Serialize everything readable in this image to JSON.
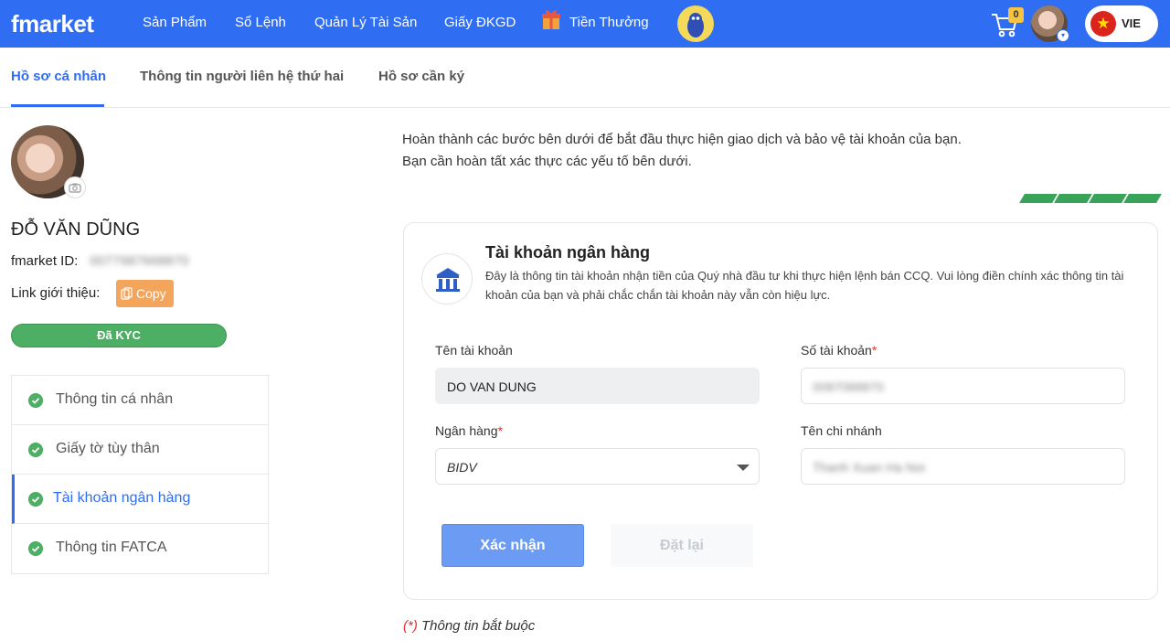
{
  "header": {
    "logo": "fmarket",
    "nav": [
      "Sản Phẩm",
      "Sổ Lệnh",
      "Quản Lý Tài Sản",
      "Giấy ĐKGD",
      "Tiền Thưởng"
    ],
    "cart_count": "0",
    "language": "VIE"
  },
  "tabs": [
    "Hồ sơ cá nhân",
    "Thông tin người liên hệ thứ hai",
    "Hồ sơ cần ký"
  ],
  "profile": {
    "name": "ĐỖ VĂN DŨNG",
    "fmarket_id_label": "fmarket ID:",
    "fmarket_id_value": "0077987668870",
    "referral_label": "Link giới thiệu:",
    "copy_label": "Copy",
    "kyc_status": "Đã KYC"
  },
  "steps": [
    {
      "label": "Thông tin cá nhân"
    },
    {
      "label": "Giấy tờ tùy thân"
    },
    {
      "label": "Tài khoản ngân hàng"
    },
    {
      "label": "Thông tin FATCA"
    }
  ],
  "intro": {
    "line1": "Hoàn thành các bước bên dưới để bắt đầu thực hiện giao dịch và bảo vệ tài khoản của bạn.",
    "line2": "Bạn cần hoàn tất xác thực các yếu tố bên dưới."
  },
  "bank_card": {
    "title": "Tài khoản ngân hàng",
    "description": "Đây là thông tin tài khoản nhận tiền của Quý nhà đầu tư khi thực hiện lệnh bán CCQ. Vui lòng điền chính xác thông tin tài khoản của bạn và phải chắc chắn tài khoản này vẫn còn hiệu lực.",
    "account_name_label": "Tên tài khoản",
    "account_name_value": "DO VAN DUNG",
    "account_number_label": "Số tài khoản",
    "account_number_value": "0087088870",
    "bank_label": "Ngân hàng",
    "bank_value": "BIDV",
    "branch_label": "Tên chi nhánh",
    "branch_value": "Thanh Xuan Ha Noi",
    "required_mark": "*",
    "confirm_label": "Xác nhận",
    "reset_label": "Đặt lại"
  },
  "footnote": {
    "mark": "(*)",
    "text": " Thông tin bắt buộc"
  },
  "colors": {
    "brand_blue": "#2f6df2",
    "success_green": "#4caf63",
    "copy_orange": "#f3a55c"
  }
}
